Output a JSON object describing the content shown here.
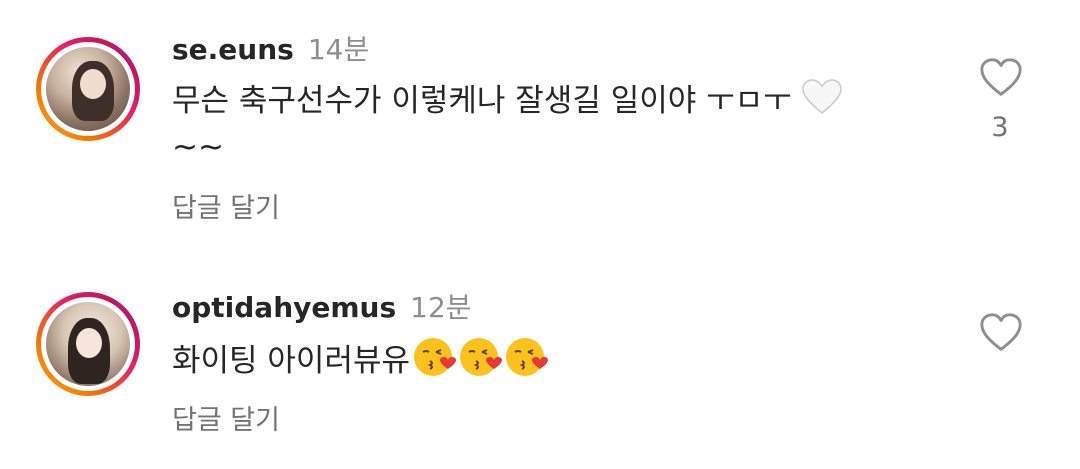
{
  "comments": [
    {
      "username": "se.euns",
      "time": "14분",
      "text": "무슨 축구선수가 이렇케나 잘생길 일이야 ㅜㅁㅜ ",
      "text_cont": "~~",
      "emoji": "white-heart",
      "reply_label": "답글 달기",
      "like_count": "3"
    },
    {
      "username": "optidahyemus",
      "time": "12분",
      "text": "화이팅 아이러뷰유",
      "emojis": [
        "kissing-heart-face",
        "kissing-heart-face",
        "kissing-heart-face"
      ],
      "reply_label": "답글 달기"
    }
  ],
  "colors": {
    "text": "#262626",
    "secondary": "#8e8e8e",
    "reply": "#737373",
    "story_ring_start": "#f9a825",
    "story_ring_end": "#9c27b0"
  }
}
